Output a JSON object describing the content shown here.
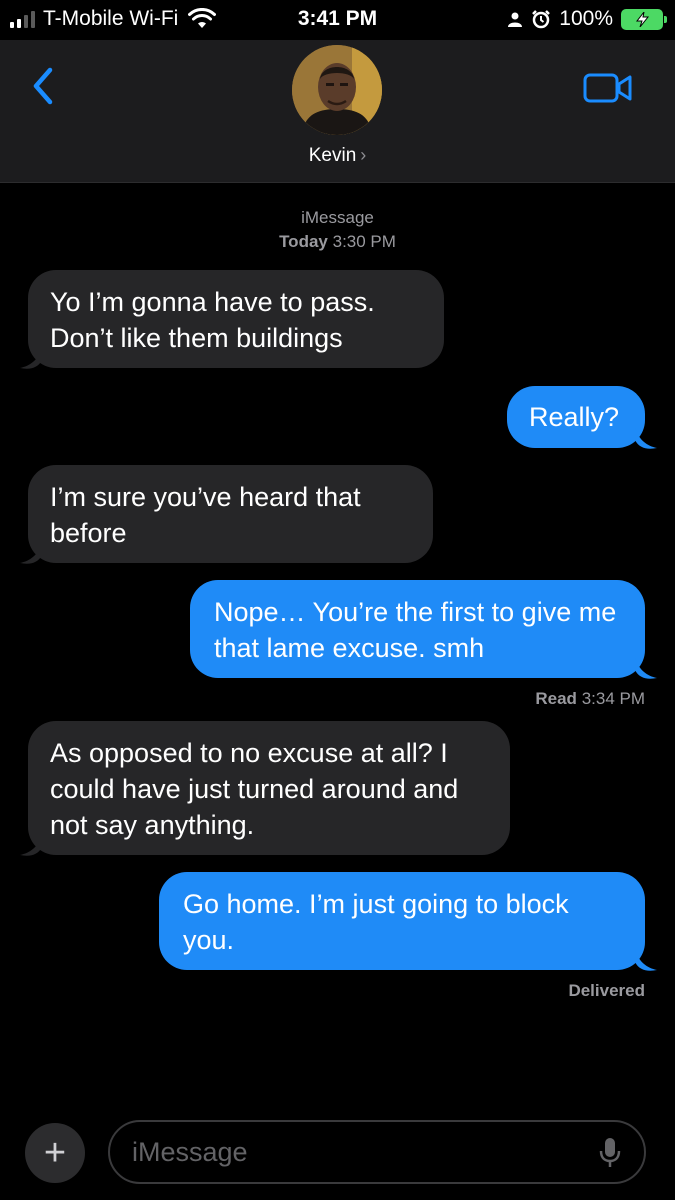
{
  "status_bar": {
    "carrier": "T-Mobile Wi-Fi",
    "time": "3:41 PM",
    "battery": "100%",
    "icons": [
      "signal-icon",
      "wifi-icon",
      "person-icon",
      "alarm-icon",
      "battery-charging-icon"
    ]
  },
  "header": {
    "contact_name": "Kevin",
    "chevron": "›",
    "icons": [
      "back-chevron-icon",
      "video-camera-icon"
    ]
  },
  "conversation": {
    "service": "iMessage",
    "timestamp_day": "Today",
    "timestamp_time": "3:30 PM",
    "messages": [
      {
        "direction": "incoming",
        "text": "Yo I’m gonna have to pass. Don’t like them buildings"
      },
      {
        "direction": "outgoing",
        "text": "Really?"
      },
      {
        "direction": "incoming",
        "text": "I’m sure you’ve heard that before"
      },
      {
        "direction": "outgoing",
        "text": "Nope… You’re the first to give me that lame excuse. smh"
      },
      {
        "direction": "incoming",
        "text": "As opposed to no excuse at all? I could have just turned around and not say anything."
      },
      {
        "direction": "outgoing",
        "text": "Go home. I’m just going to block you."
      }
    ],
    "read_label": "Read",
    "read_time": "3:34 PM",
    "delivered_label": "Delivered"
  },
  "input_bar": {
    "plus": "+",
    "placeholder": "iMessage",
    "icons": [
      "plus-icon",
      "microphone-icon"
    ]
  },
  "colors": {
    "outgoing_bubble": "#1f8bf7",
    "incoming_bubble": "#262628",
    "accent": "#1a8cff",
    "battery": "#4cd964"
  }
}
